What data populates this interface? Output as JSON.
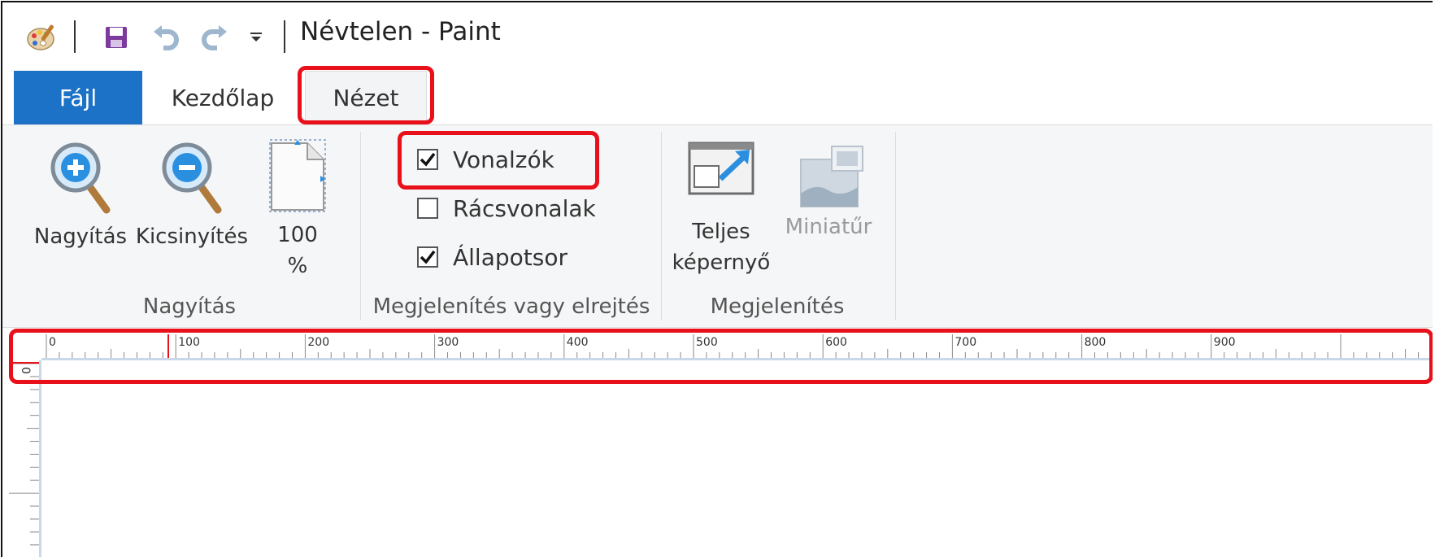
{
  "window": {
    "title": "Névtelen - Paint"
  },
  "quick_access": {
    "app_icon": "paint-palette-icon",
    "save_icon": "save-icon",
    "undo_icon": "undo-icon",
    "redo_icon": "redo-icon",
    "customize_icon": "dropdown-arrow-icon"
  },
  "tabs": [
    {
      "label": "Fájl",
      "active": false
    },
    {
      "label": "Kezdőlap",
      "active": false
    },
    {
      "label": "Nézet",
      "active": true
    }
  ],
  "ribbon": {
    "zoom_group": {
      "label": "Nagyítás",
      "zoom_in": "Nagyítás",
      "zoom_out": "Kicsinyítés",
      "hundred_line1": "100",
      "hundred_line2": "%"
    },
    "show_hide_group": {
      "label": "Megjelenítés vagy elrejtés",
      "rulers": {
        "label": "Vonalzók",
        "checked": true
      },
      "gridlines": {
        "label": "Rácsvonalak",
        "checked": false
      },
      "statusbar": {
        "label": "Állapotsor",
        "checked": true
      }
    },
    "display_group": {
      "label": "Megjelenítés",
      "fullscreen_line1": "Teljes",
      "fullscreen_line2": "képernyő",
      "thumbnail": "Miniatűr"
    }
  },
  "ruler": {
    "horizontal_labels": [
      "0",
      "100",
      "200",
      "300",
      "400",
      "500",
      "600",
      "700",
      "800",
      "900"
    ],
    "vertical_labels": [
      "0"
    ]
  },
  "colors": {
    "file_tab": "#1b72c7",
    "highlight": "#e8101a",
    "ruler_border": "#c8d8ea"
  }
}
